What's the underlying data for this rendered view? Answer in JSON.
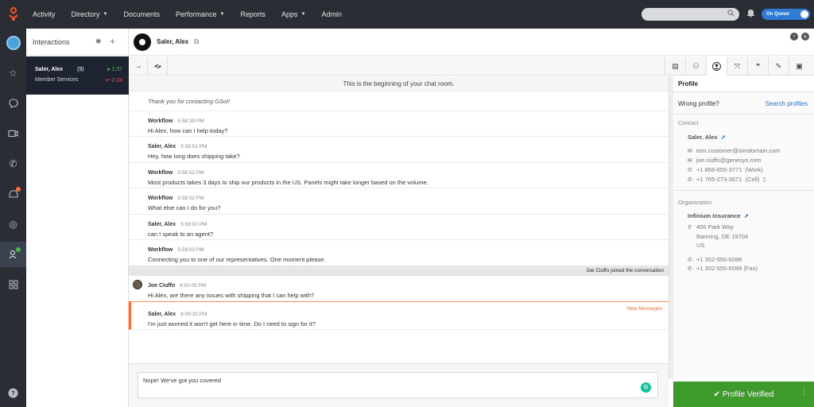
{
  "nav": {
    "items": [
      {
        "label": "Activity",
        "caret": false
      },
      {
        "label": "Directory",
        "caret": true
      },
      {
        "label": "Documents",
        "caret": false
      },
      {
        "label": "Performance",
        "caret": true
      },
      {
        "label": "Reports",
        "caret": false
      },
      {
        "label": "Apps",
        "caret": true
      },
      {
        "label": "Admin",
        "caret": false
      }
    ],
    "status_label": "On Queue"
  },
  "interactions": {
    "title": "Interactions",
    "card": {
      "name": "Saler, Alex",
      "count": "(9)",
      "queue": "Member Services",
      "timer_active": "1:37",
      "timer_wait": "0:24"
    }
  },
  "conversation": {
    "contact_name": "Saler, Alex",
    "start_notice": "This is the beginning of your chat room.",
    "welcome": "Thank you for contacting GSol!",
    "messages": [
      {
        "who": "Workflow",
        "time": "5:58:39 PM",
        "text": "Hi Alex, how can I help today?"
      },
      {
        "who": "Saler, Alex",
        "time": "5:58:51 PM",
        "text": "Hey, how long does shipping take?"
      },
      {
        "who": "Workflow",
        "time": "5:58:52 PM",
        "text": "Most products takes 3 days to ship our products in the US. Panels might take longer based on the volume."
      },
      {
        "who": "Workflow",
        "time": "5:58:52 PM",
        "text": "What else can I do for you?"
      },
      {
        "who": "Saler, Alex",
        "time": "5:59:00 PM",
        "text": "can I speak to an agent?"
      },
      {
        "who": "Workflow",
        "time": "5:59:03 PM",
        "text": "Connecting you to one of our representatives. One moment please."
      }
    ],
    "join_notice": "Joe Ciuffo joined the conversation",
    "agent_message": {
      "who": "Joe Ciuffo",
      "time": "6:00:05 PM",
      "text": "Hi Alex, are there any issues with shipping that I can help with?"
    },
    "new_messages_label": "New Messages",
    "last_message": {
      "who": "Saler, Alex",
      "time": "6:00:20 PM",
      "text": "I'm just worried it won't get here in time. Do I need to sign for it?"
    },
    "composer_text": "Nope! We've got you covered"
  },
  "profile": {
    "title": "Profile",
    "wrong_profile": "Wrong profile?",
    "search_link": "Search profiles",
    "contact_section": "Contact",
    "contact_name": "Saler, Alex",
    "email1": "tom.customer@simdomain.com",
    "email2": "joe.ciuffo@genesys.com",
    "phone_work": "+1 856-655-3771",
    "phone_work_label": "(Work)",
    "phone_cell": "+1 765-273-3671",
    "phone_cell_label": "(Cell)",
    "org_section": "Organization",
    "org_name": "Infinium Insurance",
    "address1": "456 Park Way",
    "address2": "Banning, DE 19704",
    "address3": "US",
    "org_phone": "+1 302-555-6098",
    "org_fax": "+1 302-555-6099",
    "org_fax_label": "(Fax)",
    "verified_label": "Profile Verified"
  },
  "colors": {
    "topbar": "#2a2d34",
    "accent": "#2f7bd6",
    "verified": "#3d9a2b",
    "new_messages": "#ff6a2a"
  }
}
